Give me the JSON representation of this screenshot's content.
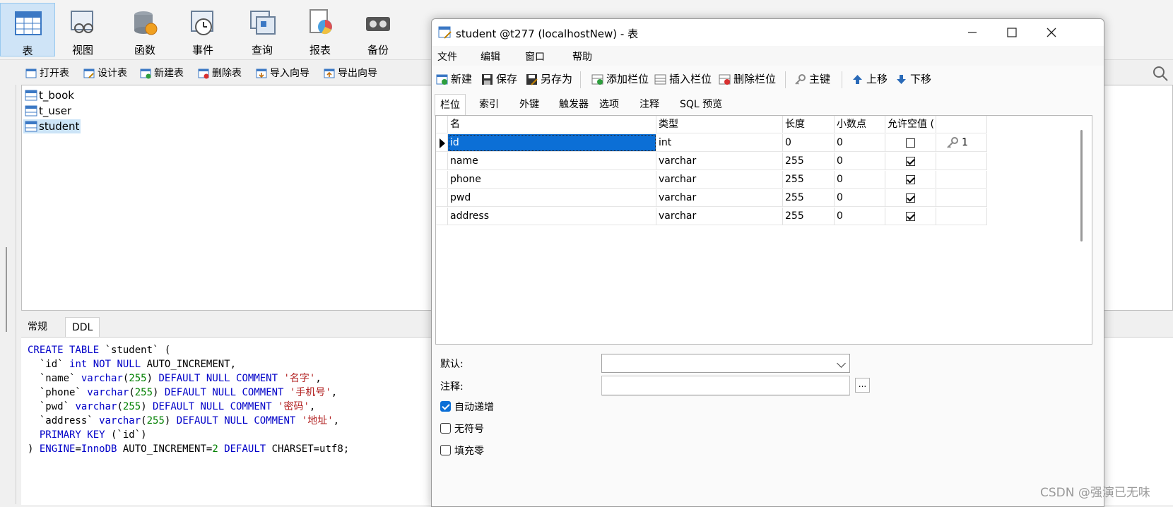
{
  "main_toolbar": {
    "buttons": [
      {
        "label": "表"
      },
      {
        "label": "视图"
      },
      {
        "label": "函数"
      },
      {
        "label": "事件"
      },
      {
        "label": "查询"
      },
      {
        "label": "报表"
      },
      {
        "label": "备份"
      }
    ]
  },
  "object_toolbar": {
    "buttons": [
      {
        "label": "打开表"
      },
      {
        "label": "设计表"
      },
      {
        "label": "新建表"
      },
      {
        "label": "删除表"
      },
      {
        "label": "导入向导"
      },
      {
        "label": "导出向导"
      }
    ]
  },
  "tree": {
    "items": [
      {
        "label": "t_book"
      },
      {
        "label": "t_user"
      },
      {
        "label": "student"
      }
    ],
    "selected": "student"
  },
  "bottom_tabs": [
    {
      "label": "常规"
    },
    {
      "label": "DDL"
    }
  ],
  "ddl": {
    "lines": [
      "CREATE TABLE `student` (",
      "  `id` int NOT NULL AUTO_INCREMENT,",
      "  `name` varchar(255) DEFAULT NULL COMMENT '名字',",
      "  `phone` varchar(255) DEFAULT NULL COMMENT '手机号',",
      "  `pwd` varchar(255) DEFAULT NULL COMMENT '密码',",
      "  `address` varchar(255) DEFAULT NULL COMMENT '地址',",
      "  PRIMARY KEY (`id`)",
      ") ENGINE=InnoDB AUTO_INCREMENT=2 DEFAULT CHARSET=utf8;"
    ]
  },
  "dialog": {
    "title": "student @t277 (localhostNew) - 表",
    "menu": [
      "文件",
      "编辑",
      "窗口",
      "帮助"
    ],
    "toolbar": {
      "new": "新建",
      "save": "保存",
      "save_as": "另存为",
      "add_field": "添加栏位",
      "insert_field": "插入栏位",
      "delete_field": "删除栏位",
      "primary_key": "主键",
      "move_up": "上移",
      "move_down": "下移"
    },
    "tabs": [
      "栏位",
      "索引",
      "外键",
      "触发器",
      "选项",
      "注释",
      "SQL 预览"
    ],
    "active_tab": "栏位",
    "grid": {
      "headers": [
        "名",
        "类型",
        "长度",
        "小数点",
        "允许空值 ("
      ],
      "rows": [
        {
          "name": "id",
          "type": "int",
          "length": "0",
          "decimals": "0",
          "nullable": false,
          "key": "1"
        },
        {
          "name": "name",
          "type": "varchar",
          "length": "255",
          "decimals": "0",
          "nullable": true,
          "key": ""
        },
        {
          "name": "phone",
          "type": "varchar",
          "length": "255",
          "decimals": "0",
          "nullable": true,
          "key": ""
        },
        {
          "name": "pwd",
          "type": "varchar",
          "length": "255",
          "decimals": "0",
          "nullable": true,
          "key": ""
        },
        {
          "name": "address",
          "type": "varchar",
          "length": "255",
          "decimals": "0",
          "nullable": true,
          "key": ""
        }
      ]
    },
    "props": {
      "default_label": "默认:",
      "default_value": "",
      "comment_label": "注释:",
      "comment_value": "",
      "ellipsis": "...",
      "auto_increment": {
        "label": "自动递增",
        "checked": true
      },
      "unsigned": {
        "label": "无符号",
        "checked": false
      },
      "zerofill": {
        "label": "填充零",
        "checked": false
      }
    }
  },
  "watermark": "CSDN @强演已无味",
  "colors": {
    "selection": "#0c6fd6",
    "keyword": "#0000c8",
    "string": "#b22222",
    "number": "#008000"
  }
}
